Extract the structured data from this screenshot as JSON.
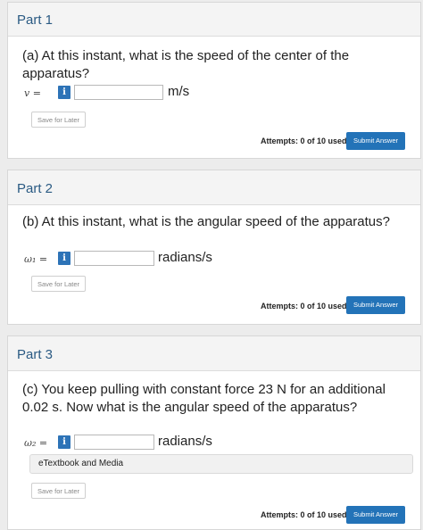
{
  "parts": [
    {
      "title": "Part 1",
      "question": "(a) At this instant, what is the speed of the center of the apparatus?",
      "var_label": "v =",
      "info_icon": "i",
      "input_value": "",
      "unit": "m/s",
      "save_label": "Save for Later",
      "attempts": "Attempts: 0 of 10 used",
      "submit_label": "Submit Answer"
    },
    {
      "title": "Part 2",
      "question": "(b) At this instant, what is the angular speed of the apparatus?",
      "var_label": "ω₁ =",
      "info_icon": "i",
      "input_value": "",
      "unit": "radians/s",
      "save_label": "Save for Later",
      "attempts": "Attempts: 0 of 10 used",
      "submit_label": "Submit Answer"
    },
    {
      "title": "Part 3",
      "question": "(c) You keep pulling with constant force 23 N for an additional 0.02 s. Now what is the angular speed of the apparatus?",
      "var_label": "ω₂ =",
      "info_icon": "i",
      "input_value": "",
      "unit": "radians/s",
      "etextbook_label": "eTextbook and Media",
      "save_label": "Save for Later",
      "attempts": "Attempts: 0 of 10 used",
      "submit_label": "Submit Answer"
    }
  ],
  "colors": {
    "accent": "#2373b8",
    "title": "#2a5a83",
    "background": "#ececec"
  }
}
